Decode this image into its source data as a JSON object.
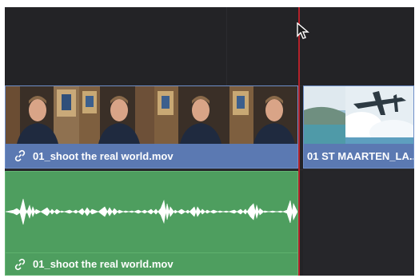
{
  "timeline": {
    "video_track": {
      "clips": [
        {
          "name": "01_shoot the real world.mov",
          "link_icon": "link-icon"
        },
        {
          "name": "01 ST MAARTEN_LA..."
        }
      ]
    },
    "audio_track": {
      "clips": [
        {
          "name": "01_shoot the real world.mov",
          "link_icon": "link-icon"
        }
      ]
    },
    "colors": {
      "video_clip": "#5b79b2",
      "audio_clip": "#4e9e5f",
      "playhead": "#b4222a",
      "background": "#232326"
    }
  },
  "cursor": {
    "icon": "arrow-pointer-icon"
  }
}
